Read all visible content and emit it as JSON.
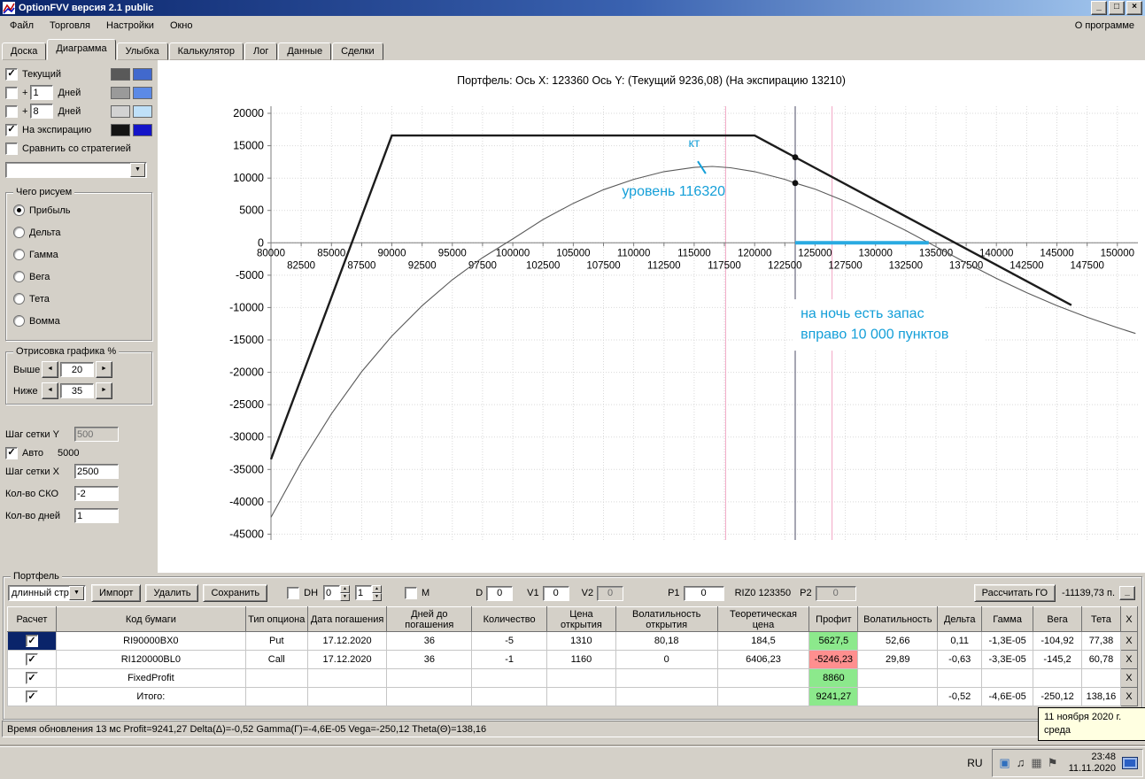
{
  "window": {
    "title": "OptionFVV версия 2.1 public"
  },
  "icons": {
    "minimize": "_",
    "maximize": "□",
    "close": "×",
    "combo_arrow": "▼",
    "left_arrow": "◄",
    "right_arrow": "►",
    "spin_up": "▲",
    "spin_down": "▼"
  },
  "menubar": {
    "items": [
      {
        "name": "file",
        "label": "Файл"
      },
      {
        "name": "trading",
        "label": "Торговля"
      },
      {
        "name": "settings",
        "label": "Настройки"
      },
      {
        "name": "window",
        "label": "Окно"
      }
    ],
    "about_label": "О программе"
  },
  "tabs": {
    "items": [
      {
        "name": "board",
        "label": "Доска",
        "active": false
      },
      {
        "name": "diagram",
        "label": "Диаграмма",
        "active": true
      },
      {
        "name": "smile",
        "label": "Улыбка",
        "active": false
      },
      {
        "name": "calculator",
        "label": "Калькулятор",
        "active": false
      },
      {
        "name": "log",
        "label": "Лог",
        "active": false
      },
      {
        "name": "data",
        "label": "Данные",
        "active": false
      },
      {
        "name": "deals",
        "label": "Сделки",
        "active": false
      }
    ]
  },
  "left_panel": {
    "row_current": {
      "label": "Текущий",
      "checked": true,
      "c1": "#595959",
      "c2": "#4169cd"
    },
    "row_day1": {
      "prefix": "+",
      "value": "1",
      "label": "Дней",
      "checked": false,
      "c1": "#9a9a9a",
      "c2": "#5c8ae6"
    },
    "row_day8": {
      "prefix": "+",
      "value": "8",
      "label": "Дней",
      "checked": false,
      "c1": "#d2d2d2",
      "c2": "#bfe0f8"
    },
    "row_expiration": {
      "label": "На экспирацию",
      "checked": true,
      "c1": "#141414",
      "c2": "#1414c8"
    },
    "row_compare": {
      "label": "Сравнить со стратегией",
      "checked": false
    },
    "strategy_value": "",
    "draw_group": {
      "title": "Чего рисуем",
      "selected": "Прибыль",
      "options": [
        {
          "name": "profit",
          "label": "Прибыль"
        },
        {
          "name": "delta",
          "label": "Дельта"
        },
        {
          "name": "gamma",
          "label": "Гамма"
        },
        {
          "name": "vega",
          "label": "Вега"
        },
        {
          "name": "theta",
          "label": "Тета"
        },
        {
          "name": "vomma",
          "label": "Вомма"
        }
      ]
    },
    "render_group": {
      "title": "Отрисовка графика %",
      "above_label": "Выше",
      "above_value": "20",
      "below_label": "Ниже",
      "below_value": "35"
    },
    "grid_y_label": "Шаг сетки Y",
    "grid_y_value": "500",
    "auto_label": "Авто",
    "auto_checked": true,
    "auto_value": "5000",
    "grid_x_label": "Шаг сетки X",
    "grid_x_value": "2500",
    "sko_label": "Кол-во СКО",
    "sko_value": "-2",
    "days_label": "Кол-во дней",
    "days_value": "1"
  },
  "chart_data": {
    "type": "line",
    "title": "Портфель: Ось X: 123360 Ось Y:  (Текущий 9236,08)  (На экспирацию 13210)",
    "x_axis": {
      "min": 80000,
      "max": 151700,
      "grid_step": 2500,
      "major_labels": [
        80000,
        85000,
        90000,
        95000,
        100000,
        105000,
        110000,
        115000,
        120000,
        125000,
        130000,
        135000,
        140000,
        145000,
        150000
      ],
      "minor_labels": [
        82500,
        87500,
        92500,
        97500,
        102500,
        107500,
        112500,
        117500,
        122500,
        127500,
        132500,
        137500,
        142500,
        147500
      ]
    },
    "y_axis": {
      "min": -45900,
      "max": 21100,
      "grid_step": 5000,
      "labels": [
        20000,
        15000,
        10000,
        5000,
        0,
        -5000,
        -10000,
        -15000,
        -20000,
        -25000,
        -30000,
        -35000,
        -40000,
        -45000
      ]
    },
    "series": [
      {
        "name": "На экспирацию",
        "color": "#1c1c1c",
        "width": 2.4,
        "points": [
          [
            80000,
            -33430
          ],
          [
            90000,
            16570
          ],
          [
            120000,
            16570
          ],
          [
            146200,
            -9630
          ]
        ]
      },
      {
        "name": "Текущий",
        "color": "#5a5a5a",
        "width": 1.1,
        "points": [
          [
            80000,
            -42400
          ],
          [
            82500,
            -33900
          ],
          [
            85000,
            -26400
          ],
          [
            87500,
            -19900
          ],
          [
            90000,
            -14400
          ],
          [
            92500,
            -9700
          ],
          [
            95000,
            -5700
          ],
          [
            97500,
            -2300
          ],
          [
            100000,
            600
          ],
          [
            102500,
            3600
          ],
          [
            105000,
            6100
          ],
          [
            107500,
            8200
          ],
          [
            110000,
            9800
          ],
          [
            112500,
            11000
          ],
          [
            115000,
            11650
          ],
          [
            116500,
            11800
          ],
          [
            118000,
            11600
          ],
          [
            120000,
            11000
          ],
          [
            122500,
            9800
          ],
          [
            123360,
            9236
          ],
          [
            125000,
            8300
          ],
          [
            127500,
            6400
          ],
          [
            130000,
            4200
          ],
          [
            132500,
            1900
          ],
          [
            135000,
            -600
          ],
          [
            137500,
            -3100
          ],
          [
            140000,
            -5500
          ],
          [
            142500,
            -7700
          ],
          [
            145000,
            -9700
          ],
          [
            147500,
            -11500
          ],
          [
            150000,
            -13100
          ],
          [
            151500,
            -14000
          ]
        ]
      }
    ],
    "vlines": [
      {
        "x": 117600,
        "color": "#f2a6c4",
        "width": 1,
        "name": "sigma-line-left"
      },
      {
        "x": 126400,
        "color": "#f2a6c4",
        "width": 1,
        "name": "sigma-line-right"
      },
      {
        "x": 123360,
        "color": "#6a6a80",
        "width": 1.2,
        "name": "current-price-line"
      }
    ],
    "markers": [
      {
        "x": 123360,
        "y": 13210
      },
      {
        "x": 123360,
        "y": 9236
      }
    ],
    "zero_segment": {
      "x1": 123360,
      "x2": 134400,
      "color": "#29aae1",
      "width": 4
    },
    "annotation_color": "#149fd8",
    "pointer_tick": {
      "x1": 115300,
      "y1": 12600,
      "x2": 115950,
      "y2": 10700
    },
    "annotations": [
      {
        "id": "kt",
        "text": "кт",
        "x": 115000,
        "y": 14800,
        "size": 14
      },
      {
        "id": "level",
        "text": "уровень 116320",
        "x": 113300,
        "y": 7300,
        "size": 16
      },
      {
        "id": "note",
        "lines": [
          "на ночь есть запас",
          "вправо  10 000 пунктов"
        ],
        "x": 123800,
        "y": -11600,
        "size": 16,
        "bg": "#ffffff"
      }
    ]
  },
  "portfolio": {
    "group_title": "Портфель",
    "controls": {
      "strategy_value": "длинный стре",
      "import_label": "Импорт",
      "delete_label": "Удалить",
      "save_label": "Сохранить",
      "dh_label": "DH",
      "dh_checked": false,
      "dh_spin1": "0",
      "dh_spin2": "1",
      "m_label": "М",
      "m_checked": false,
      "d_label": "D",
      "d_value": "0",
      "v1_label": "V1",
      "v1_value": "0",
      "v2_label": "V2",
      "v2_value": "0",
      "p1_label": "P1",
      "p1_value": "0",
      "riz_label": "RIZ0 123350",
      "p2_label": "P2",
      "p2_value": "0",
      "calc_go_label": "Рассчитать ГО",
      "go_value": "-11139,73 п.",
      "collapse_label": "_"
    },
    "table": {
      "columns": [
        "Расчет",
        "Код бумаги",
        "Тип опциона",
        "Дата погашения",
        "Дней до погашения",
        "Количество",
        "Цена открытия",
        "Волатильность открытия",
        "Теоретическая цена",
        "Профит",
        "Волатильность",
        "Дельта",
        "Гамма",
        "Вега",
        "Тета",
        "X"
      ],
      "delete_label": "X",
      "rows": [
        {
          "checked": true,
          "selected": true,
          "profit_positive": true,
          "cells": [
            "RI90000BX0",
            "Put",
            "17.12.2020",
            "36",
            "-5",
            "1310",
            "80,18",
            "184,5",
            "5627,5",
            "52,66",
            "0,11",
            "-1,3E-05",
            "-104,92",
            "77,38"
          ]
        },
        {
          "checked": true,
          "selected": false,
          "profit_positive": false,
          "cells": [
            "RI120000BL0",
            "Call",
            "17.12.2020",
            "36",
            "-1",
            "1160",
            "0",
            "6406,23",
            "-5246,23",
            "29,89",
            "-0,63",
            "-3,3E-05",
            "-145,2",
            "60,78"
          ]
        },
        {
          "checked": true,
          "selected": false,
          "profit_positive": true,
          "cells": [
            "FixedProfit",
            "",
            "",
            "",
            "",
            "",
            "",
            "",
            "8860",
            "",
            "",
            "",
            "",
            ""
          ]
        },
        {
          "checked": true,
          "selected": false,
          "profit_positive": true,
          "cells": [
            "Итого:",
            "",
            "",
            "",
            "",
            "",
            "",
            "",
            "9241,27",
            "",
            "-0,52",
            "-4,6E-05",
            "-250,12",
            "138,16"
          ]
        }
      ]
    }
  },
  "statusbar": {
    "text": "Время обновления 13 мс  Profit=9241,27 Delta(Δ)=-0,52 Gamma(Г)=-4,6E-05 Vega=-250,12 Theta(Θ)=138,16"
  },
  "tooltip": {
    "line1": "11 ноября 2020 г.",
    "line2": "среда"
  },
  "taskbar": {
    "lang": "RU",
    "time": "23:48",
    "date": "11.11.2020",
    "tray_icons": [
      {
        "name": "chart-app-tray-icon",
        "glyph": "▣",
        "color": "#2f6fbe"
      },
      {
        "name": "volume-icon",
        "glyph": "♫",
        "color": "#222222"
      },
      {
        "name": "display-tray-icon",
        "glyph": "▦",
        "color": "#555555"
      },
      {
        "name": "flag-icon",
        "glyph": "⚑",
        "color": "#444444"
      }
    ]
  }
}
